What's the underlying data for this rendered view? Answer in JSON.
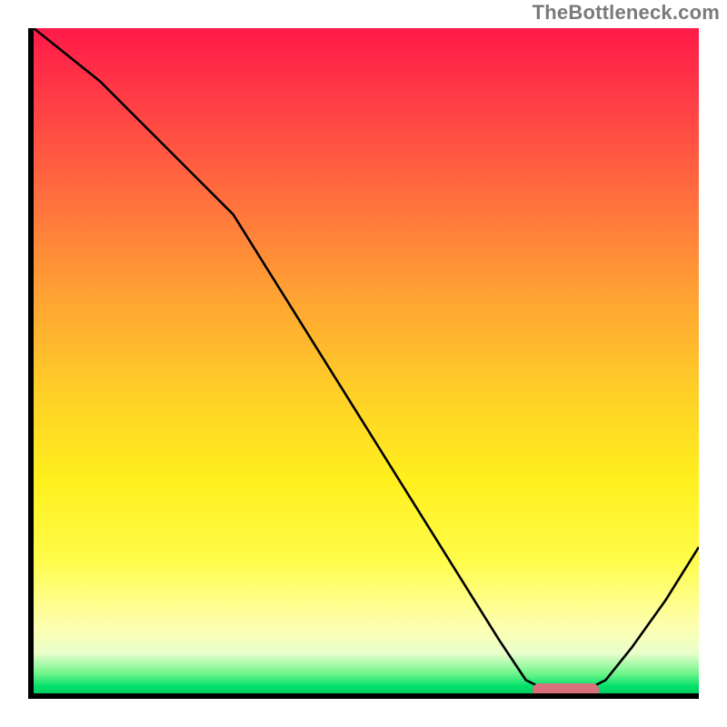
{
  "watermark": "TheBottleneck.com",
  "chart_data": {
    "type": "line",
    "title": "",
    "xlabel": "",
    "ylabel": "",
    "xlim": [
      0,
      100
    ],
    "ylim": [
      0,
      100
    ],
    "grid": false,
    "background_gradient": {
      "direction": "vertical",
      "stops": [
        {
          "pos": 0.0,
          "color": "#ff1a48"
        },
        {
          "pos": 0.1,
          "color": "#ff3a46"
        },
        {
          "pos": 0.25,
          "color": "#ff6d3e"
        },
        {
          "pos": 0.4,
          "color": "#ffa233"
        },
        {
          "pos": 0.55,
          "color": "#ffd027"
        },
        {
          "pos": 0.68,
          "color": "#fff01e"
        },
        {
          "pos": 0.8,
          "color": "#fffc4a"
        },
        {
          "pos": 0.9,
          "color": "#fdffb0"
        },
        {
          "pos": 0.94,
          "color": "#e9ffcc"
        },
        {
          "pos": 0.97,
          "color": "#6ff58a"
        },
        {
          "pos": 0.99,
          "color": "#00e06a"
        },
        {
          "pos": 1.0,
          "color": "#00d060"
        }
      ]
    },
    "series": [
      {
        "name": "bottleneck-curve",
        "x": [
          0,
          5,
          10,
          15,
          20,
          25,
          30,
          35,
          40,
          45,
          50,
          55,
          60,
          65,
          70,
          74,
          78,
          82,
          86,
          90,
          95,
          100
        ],
        "y": [
          100,
          96,
          92,
          87,
          82,
          77,
          72,
          64,
          56,
          48,
          40,
          32,
          24,
          16,
          8,
          2,
          0,
          0,
          2,
          7,
          14,
          22
        ]
      }
    ],
    "marker": {
      "name": "optimal-point",
      "shape": "rounded-bar",
      "x_start": 75,
      "x_end": 85,
      "y": 0,
      "color": "#d9717d"
    }
  }
}
